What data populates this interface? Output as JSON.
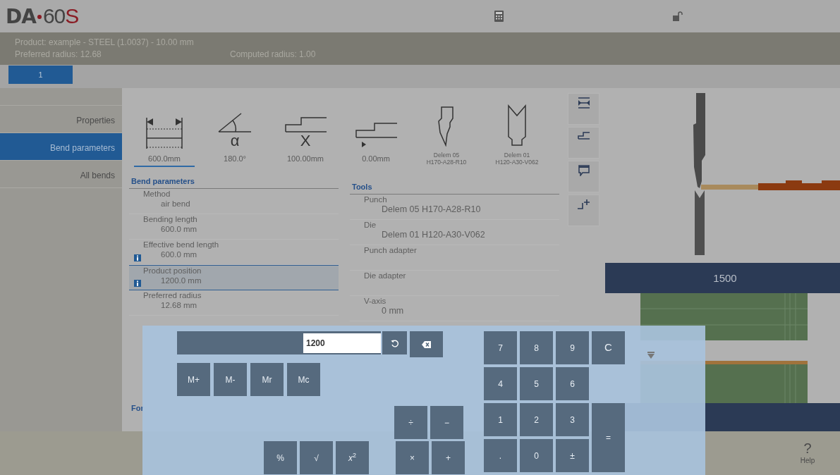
{
  "header": {
    "logo": {
      "brand": "DA",
      "model": "60",
      "suffix": "S"
    }
  },
  "info": {
    "product": "Product: example - STEEL (1.0037) - 10.00 mm",
    "preferred_radius": "Preferred radius: 12.68",
    "computed_radius": "Computed radius: 1.00"
  },
  "tabs": [
    {
      "label": "1",
      "selected": true
    }
  ],
  "sidebar": {
    "items": [
      {
        "label": "Properties",
        "selected": false
      },
      {
        "label": "Bend parameters",
        "selected": true
      },
      {
        "label": "All bends",
        "selected": false
      }
    ]
  },
  "parameter_icons": [
    {
      "kind": "length",
      "value": [
        "600.0mm"
      ],
      "selected": true
    },
    {
      "kind": "angle",
      "symbol": "α",
      "value": [
        "180.0°"
      ],
      "selected": false
    },
    {
      "kind": "offset",
      "symbol": "X",
      "value": [
        "100.00mm"
      ],
      "selected": false
    },
    {
      "kind": "step",
      "value": [
        "0.00mm"
      ],
      "selected": false
    },
    {
      "kind": "punch",
      "value": [
        "Delem 05",
        "H170-A28-R10"
      ],
      "selected": false
    },
    {
      "kind": "die",
      "value": [
        "Delem 01",
        "H120-A30-V062"
      ],
      "selected": false
    }
  ],
  "bend_parameters": {
    "title": "Bend parameters",
    "rows": [
      {
        "label": "Method",
        "value": "air bend",
        "info": false,
        "selected": false
      },
      {
        "label": "Bending length",
        "value": "600.0 mm",
        "info": false,
        "selected": false
      },
      {
        "label": "Effective bend length",
        "value": "600.0 mm",
        "info": true,
        "selected": false
      },
      {
        "label": "Product position",
        "value": "1200.0 mm",
        "info": true,
        "selected": true
      },
      {
        "label": "Preferred radius",
        "value": "12.68 mm",
        "info": false,
        "selected": false
      }
    ]
  },
  "force_section": {
    "title": "For"
  },
  "tools": {
    "title": "Tools",
    "rows": [
      {
        "label": "Punch",
        "value": "Delem 05 H170-A28-R10"
      },
      {
        "label": "Die",
        "value": "Delem 01 H120-A30-V062"
      },
      {
        "label": "Punch adapter"
      },
      {
        "label": "Die adapter"
      },
      {
        "label": "V-axis",
        "value": "0 mm"
      }
    ]
  },
  "side_buttons": [
    {
      "kind": "fit"
    },
    {
      "kind": "step"
    },
    {
      "kind": "comment"
    },
    {
      "kind": "add"
    }
  ],
  "drawing": {
    "length_label": "1500"
  },
  "help": {
    "symbol": "?",
    "label": "Help"
  },
  "calculator": {
    "value": "1200",
    "memory": [
      "M+",
      "M-",
      "Mr",
      "Mc"
    ],
    "operators_top": [
      "÷",
      "−"
    ],
    "functions": [
      "%",
      "√",
      "*x*$^{2}$"
    ],
    "operators_bottom": [
      "×",
      "+"
    ],
    "keypad": [
      {
        "label": "7",
        "kind": "key"
      },
      {
        "label": "8",
        "kind": "key"
      },
      {
        "label": "9",
        "kind": "key"
      },
      {
        "label": "C",
        "kind": "clear"
      },
      {
        "label": "4",
        "kind": "key"
      },
      {
        "label": "5",
        "kind": "key"
      },
      {
        "label": "6",
        "kind": "key"
      },
      {
        "label": "1",
        "kind": "key"
      },
      {
        "label": "2",
        "kind": "key"
      },
      {
        "label": "3",
        "kind": "key"
      },
      {
        "label": "=",
        "kind": "equals"
      },
      {
        "label": ".",
        "kind": "key"
      },
      {
        "label": "0",
        "kind": "key"
      },
      {
        "label": "±",
        "kind": "key"
      }
    ]
  }
}
